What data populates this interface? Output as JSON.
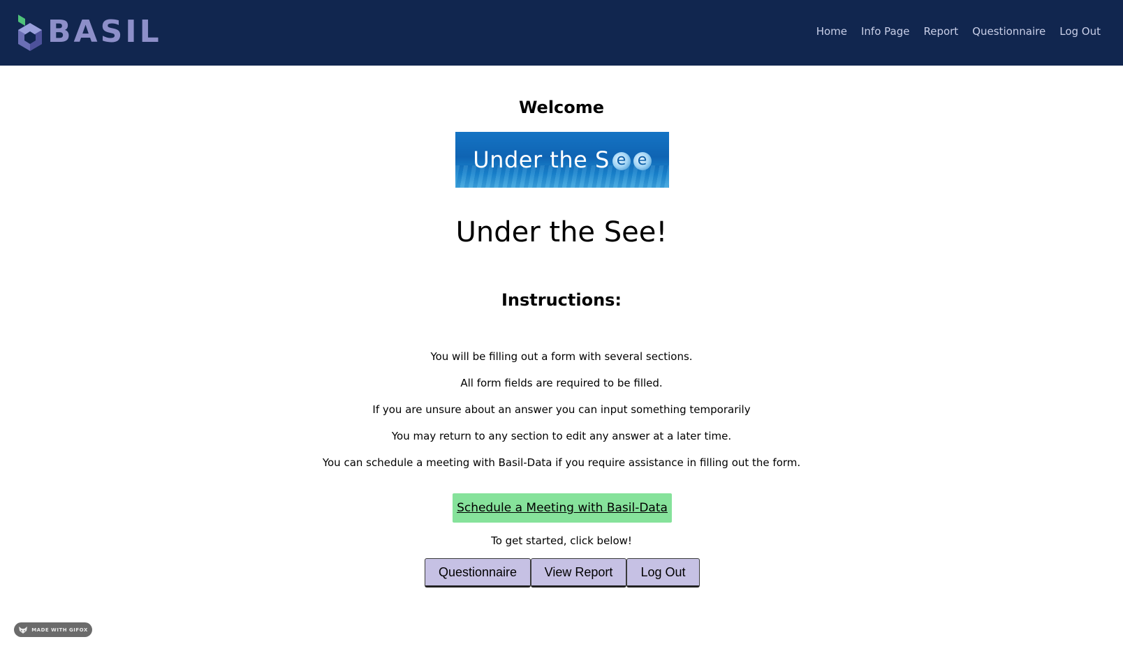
{
  "nav": {
    "brand": "BASIL",
    "links": [
      "Home",
      "Info Page",
      "Report",
      "Questionnaire",
      "Log Out"
    ]
  },
  "main": {
    "welcome": "Welcome",
    "banner_text": "Under the S",
    "banner_eye_1": "e",
    "banner_eye_2": "e",
    "title": "Under the See!",
    "instructions_heading": "Instructions:",
    "instructions": [
      "You will be filling out a form with several sections.",
      "All form fields are required to be filled.",
      "If you are unsure about an answer you can input something temporarily",
      "You may return to any section to edit any answer at a later time.",
      "You can schedule a meeting with Basil-Data if you require assistance in filling out the form."
    ],
    "schedule_button": "Schedule a Meeting with Basil-Data",
    "get_started": "To get started, click below!",
    "buttons": [
      "Questionnaire",
      "View Report",
      "Log Out"
    ]
  },
  "badge": {
    "text": "MADE WITH GIFOX"
  },
  "colors": {
    "navbar": "#11264f",
    "brand": "#8d8fc9",
    "schedule_button": "#86e29b",
    "action_button": "#c6c1e4"
  }
}
